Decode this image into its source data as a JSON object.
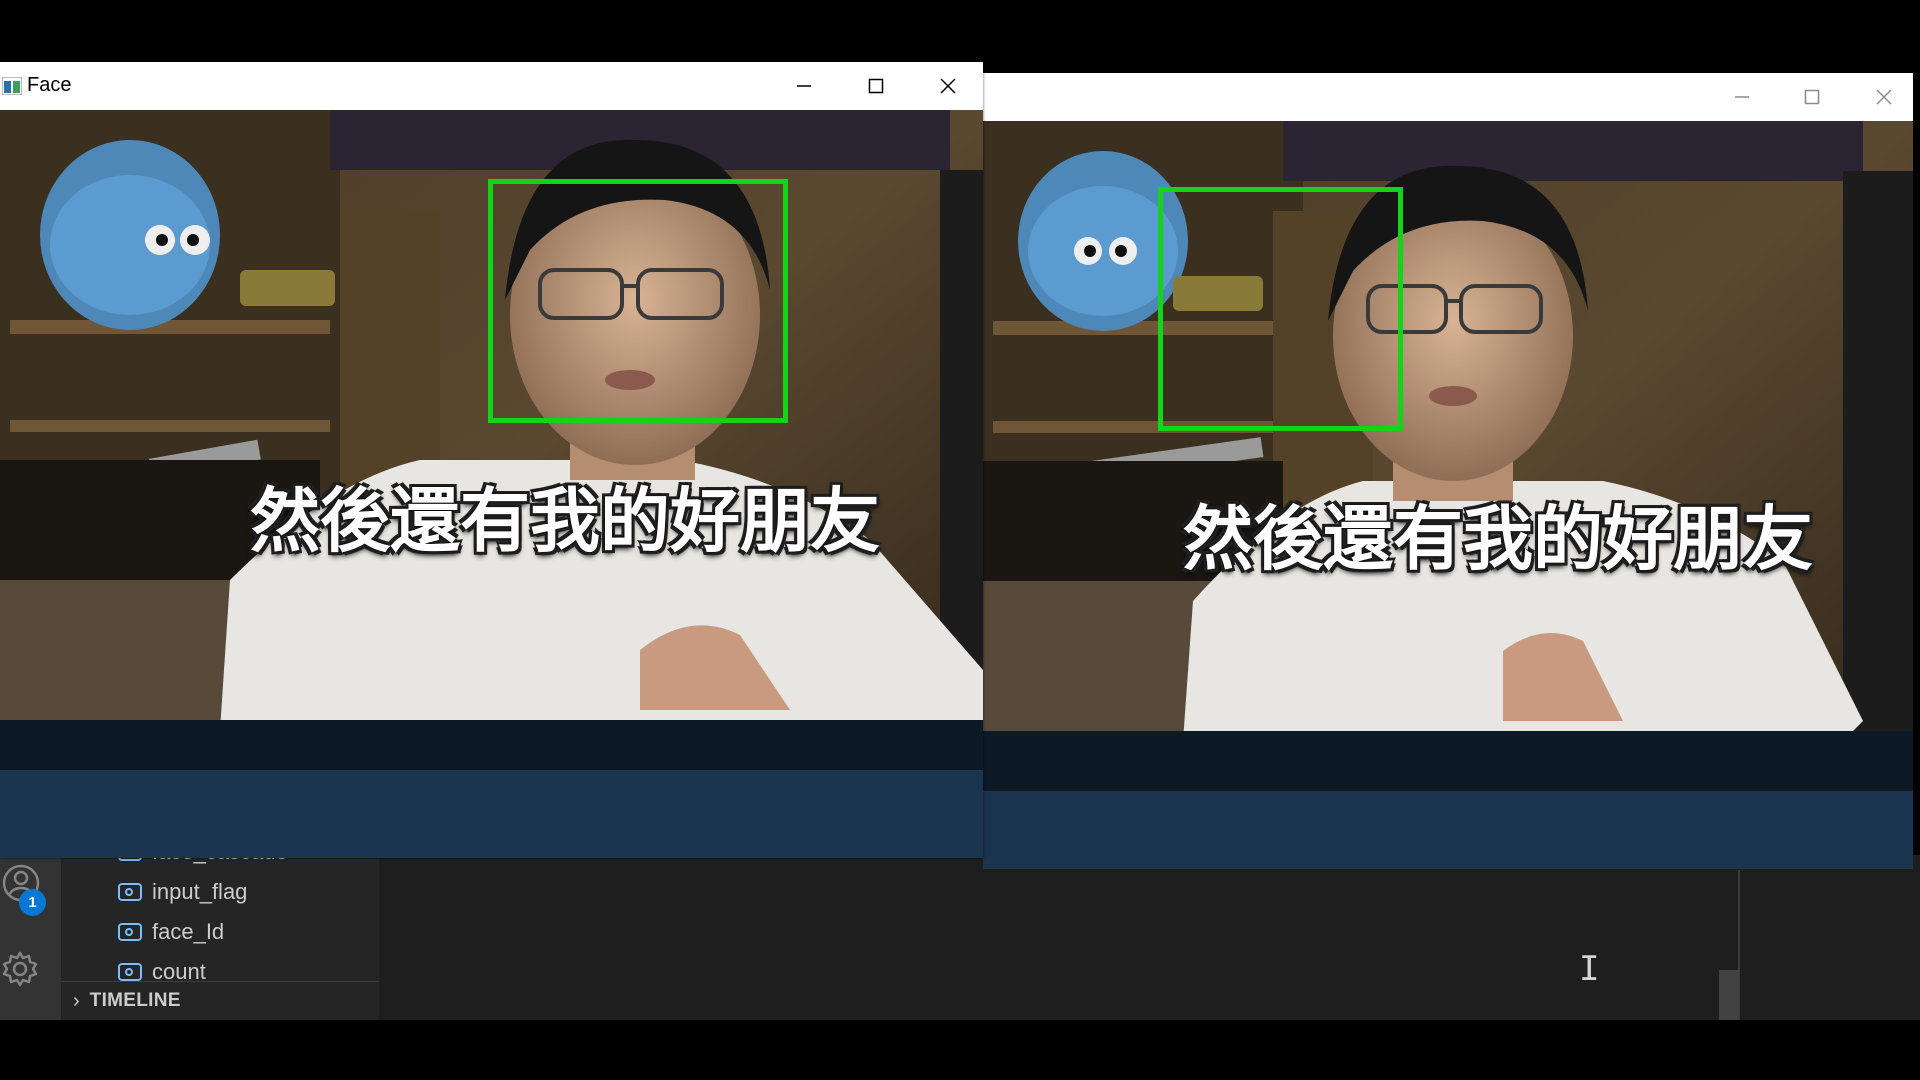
{
  "left_window": {
    "title": "Face",
    "subtitle": "然後還有我的好朋友"
  },
  "right_window": {
    "title": "",
    "subtitle": "然後還有我的好朋友"
  },
  "activity_bar": {
    "accounts_badge": "1"
  },
  "outline": {
    "items": [
      {
        "label": "face_cascade"
      },
      {
        "label": "input_flag"
      },
      {
        "label": "face_Id"
      },
      {
        "label": "count"
      }
    ]
  },
  "timeline": {
    "label": "TIMELINE"
  },
  "colors": {
    "face_box": "#14d41a",
    "badge": "#0078d4",
    "variable_icon": "#75beff"
  },
  "icons": [
    "user-icon",
    "gear-icon",
    "variable-icon",
    "chevron-right-icon",
    "minimize-icon",
    "maximize-icon",
    "close-icon",
    "text-cursor-icon"
  ]
}
